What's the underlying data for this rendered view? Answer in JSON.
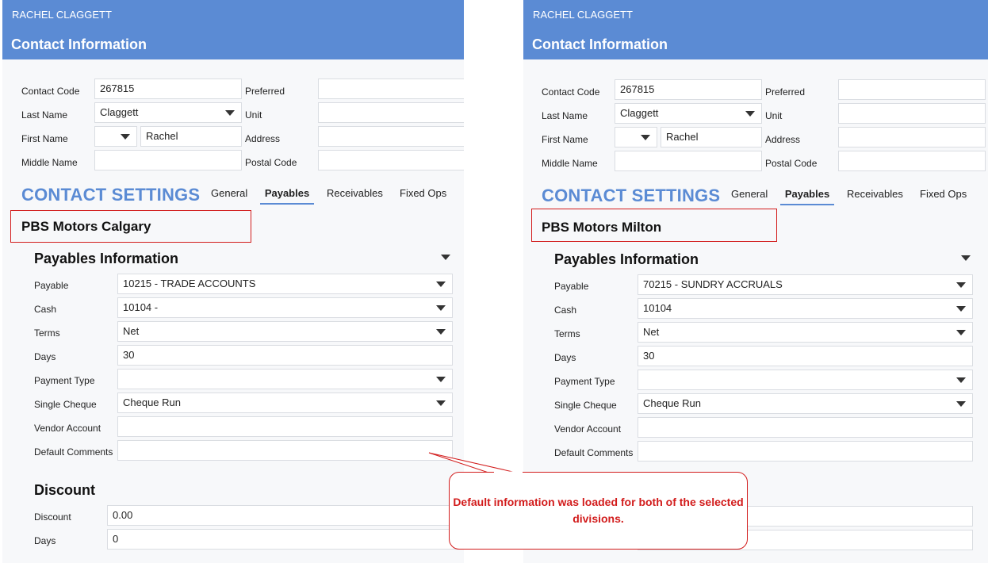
{
  "panels": [
    {
      "user": "RACHEL CLAGGETT",
      "header_title": "Contact Information",
      "labels": {
        "contact_code": "Contact Code",
        "last_name": "Last Name",
        "first_name": "First Name",
        "middle_name": "Middle Name",
        "preferred": "Preferred",
        "unit": "Unit",
        "address": "Address",
        "postal_code": "Postal Code"
      },
      "contact_code": "267815",
      "last_name": "Claggett",
      "first_name": "Rachel",
      "settings_title": "CONTACT SETTINGS",
      "tabs": [
        "General",
        "Payables",
        "Receivables",
        "Fixed Ops"
      ],
      "division": "PBS Motors Calgary",
      "payables_section": "Payables Information",
      "fields": {
        "payable": {
          "label": "Payable",
          "value": "10215 - TRADE ACCOUNTS"
        },
        "cash": {
          "label": "Cash",
          "value": "10104 -"
        },
        "terms": {
          "label": "Terms",
          "value": "Net"
        },
        "days": {
          "label": "Days",
          "value": "30"
        },
        "payment_type": {
          "label": "Payment Type",
          "value": ""
        },
        "single_cheque": {
          "label": "Single Cheque",
          "value": "Cheque Run"
        },
        "vendor_account": {
          "label": "Vendor Account",
          "value": ""
        },
        "default_comments": {
          "label": "Default Comments",
          "value": ""
        }
      },
      "discount_section": "Discount",
      "discount": {
        "label": "Discount",
        "value": "0.00"
      },
      "discount_days": {
        "label": "Days",
        "value": "0"
      }
    },
    {
      "user": "RACHEL CLAGGETT",
      "header_title": "Contact Information",
      "labels": {
        "contact_code": "Contact Code",
        "last_name": "Last Name",
        "first_name": "First Name",
        "middle_name": "Middle Name",
        "preferred": "Preferred",
        "unit": "Unit",
        "address": "Address",
        "postal_code": "Postal Code"
      },
      "contact_code": "267815",
      "last_name": "Claggett",
      "first_name": "Rachel",
      "settings_title": "CONTACT SETTINGS",
      "tabs": [
        "General",
        "Payables",
        "Receivables",
        "Fixed Ops"
      ],
      "division": "PBS Motors Milton",
      "payables_section": "Payables Information",
      "fields": {
        "payable": {
          "label": "Payable",
          "value": "70215 - SUNDRY ACCRUALS"
        },
        "cash": {
          "label": "Cash",
          "value": "10104"
        },
        "terms": {
          "label": "Terms",
          "value": "Net"
        },
        "days": {
          "label": "Days",
          "value": "30"
        },
        "payment_type": {
          "label": "Payment Type",
          "value": ""
        },
        "single_cheque": {
          "label": "Single Cheque",
          "value": "Cheque Run"
        },
        "vendor_account": {
          "label": "Vendor Account",
          "value": ""
        },
        "default_comments": {
          "label": "Default Comments",
          "value": ""
        }
      }
    }
  ],
  "callout": "Default information was loaded for both of the selected divisions.",
  "colors": {
    "header": "#5b8bd4",
    "accent": "#5b8bd4",
    "highlight_red": "#d21c1c"
  }
}
